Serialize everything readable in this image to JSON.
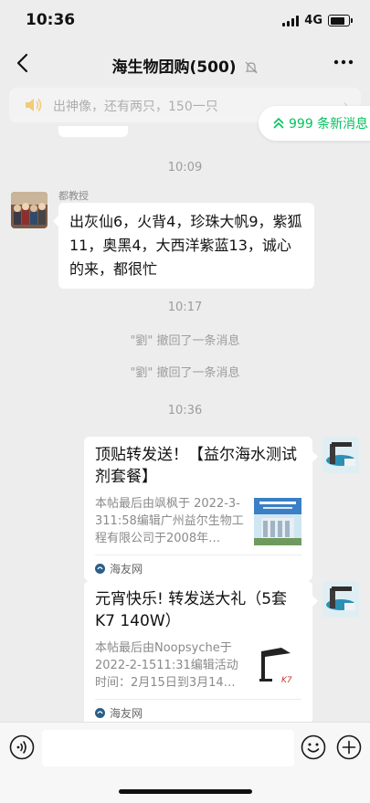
{
  "status_bar": {
    "time": "10:36",
    "network": "4G"
  },
  "nav": {
    "title": "海生物团购",
    "member_count": "(500)"
  },
  "pinned": {
    "text": "出神像，还有两只，150一只"
  },
  "new_messages": {
    "label": "999 条新消息"
  },
  "timestamps": [
    "10:09",
    "10:17",
    "10:36"
  ],
  "message_1": {
    "sender": "都教授",
    "text": "出灰仙6，火背4，珍珠大帆9，紫狐11，奥黑4，大西洋紫蓝13，诚心的来，都很忙"
  },
  "recall_notes": [
    "\"劉\" 撤回了一条消息",
    "\"劉\" 撤回了一条消息"
  ],
  "card_1": {
    "title": "顶贴转发送！【益尔海水测试剂套餐】",
    "desc": "本帖最后由飒枫于 2022-3-311:58编辑广州益尔生物工程有限公司于2008年…",
    "source": "海友网"
  },
  "card_2": {
    "title": "元宵快乐! 转发送大礼（5套K7 140W）",
    "desc": "本帖最后由Noopsyche于2022-2-1511:31编辑活动时间：2月15日到3月14…",
    "source": "海友网"
  },
  "colors": {
    "accent": "#07c160",
    "background": "#ededed",
    "bubble": "#ffffff"
  },
  "icons": [
    "back-icon",
    "mute-icon",
    "more-icon",
    "speaker-icon",
    "double-chevron-up-icon",
    "voice-icon",
    "emoji-icon",
    "plus-icon"
  ]
}
